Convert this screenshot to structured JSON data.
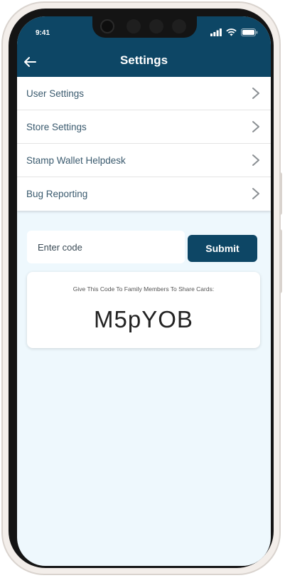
{
  "status_bar": {
    "time": "9:41"
  },
  "header": {
    "title": "Settings",
    "back_icon": "arrow-left-icon",
    "background_color": "#0d4665"
  },
  "menu": {
    "items": [
      {
        "label": "User Settings"
      },
      {
        "label": "Store Settings"
      },
      {
        "label": "Stamp Wallet Helpdesk"
      },
      {
        "label": "Bug Reporting"
      }
    ]
  },
  "code_form": {
    "placeholder": "Enter code",
    "value": "",
    "submit_label": "Submit"
  },
  "share_card": {
    "label": "Give This Code To Family Members To Share Cards:",
    "code": "M5pYOB"
  }
}
